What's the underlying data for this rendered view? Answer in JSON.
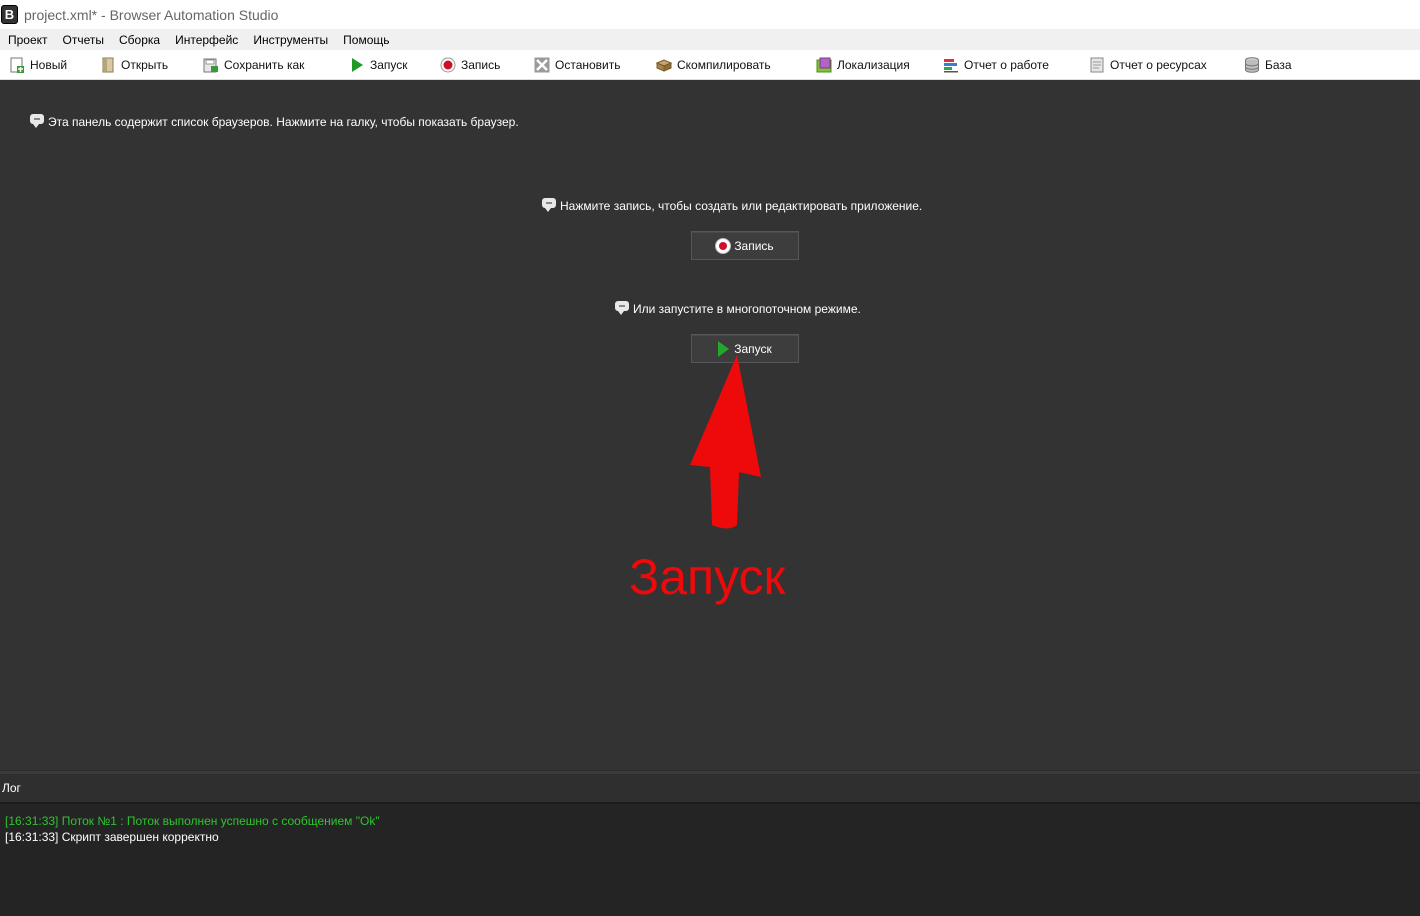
{
  "window": {
    "title": "project.xml* - Browser Automation Studio",
    "icon_letter": "B"
  },
  "menu": [
    "Проект",
    "Отчеты",
    "Сборка",
    "Интерфейс",
    "Инструменты",
    "Помощь"
  ],
  "toolbar": {
    "new": "Новый",
    "open": "Открыть",
    "save_as": "Сохранить как",
    "run": "Запуск",
    "record": "Запись",
    "stop": "Остановить",
    "compile": "Скомпилировать",
    "localization": "Локализация",
    "work_report": "Отчет о работе",
    "resources_report": "Отчет о ресурсах",
    "database": "База"
  },
  "main": {
    "browsers_hint": "Эта панель содержит список браузеров. Нажмите на галку, чтобы показать браузер.",
    "record_hint": "Нажмите запись, чтобы создать или редактировать приложение.",
    "record_button": "Запись",
    "run_hint": "Или запустите в многопоточном режиме.",
    "run_button": "Запуск",
    "annotation_label": "Запуск"
  },
  "log": {
    "title": "Лог",
    "lines": [
      {
        "text": "[16:31:33] Поток №1 : Поток выполнен успешно с сообщением \"Ok\"",
        "status": "success"
      },
      {
        "text": "[16:31:33] Скрипт завершен корректно",
        "status": "info"
      }
    ]
  },
  "colors": {
    "background": "#333333",
    "annotation": "#ee0a0a",
    "log_success": "#2fc42f"
  }
}
